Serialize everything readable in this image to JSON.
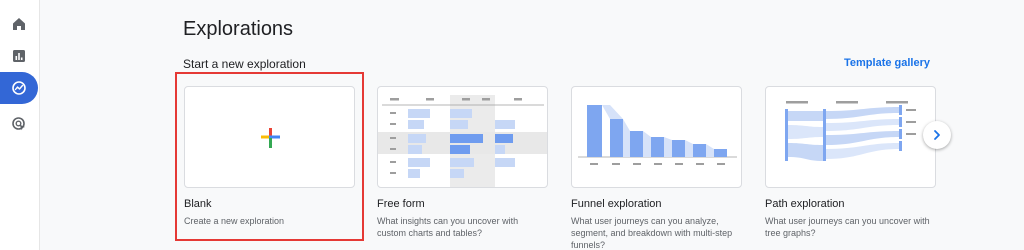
{
  "nav": {
    "items": [
      {
        "icon": "home-icon"
      },
      {
        "icon": "reports-icon"
      },
      {
        "icon": "explore-icon"
      },
      {
        "icon": "advertising-icon"
      }
    ],
    "active_index": 2,
    "accent": "#3367d6"
  },
  "page": {
    "title": "Explorations"
  },
  "start_section": {
    "heading": "Start a new exploration",
    "template_link": "Template gallery"
  },
  "cards": [
    {
      "name": "Blank",
      "description": "Create a new exploration"
    },
    {
      "name": "Free form",
      "description": "What insights can you uncover with custom charts and tables?"
    },
    {
      "name": "Funnel exploration",
      "description": "What user journeys can you analyze, segment, and breakdown with multi-step funnels?"
    },
    {
      "name": "Path exploration",
      "description": "What user journeys can you uncover with tree graphs?"
    }
  ],
  "colors": {
    "link": "#1a73e8",
    "highlight_border": "#e53935",
    "plus_blue": "#4285f4",
    "plus_red": "#ea4335",
    "plus_yellow": "#fbbc04",
    "plus_green": "#34a853"
  }
}
